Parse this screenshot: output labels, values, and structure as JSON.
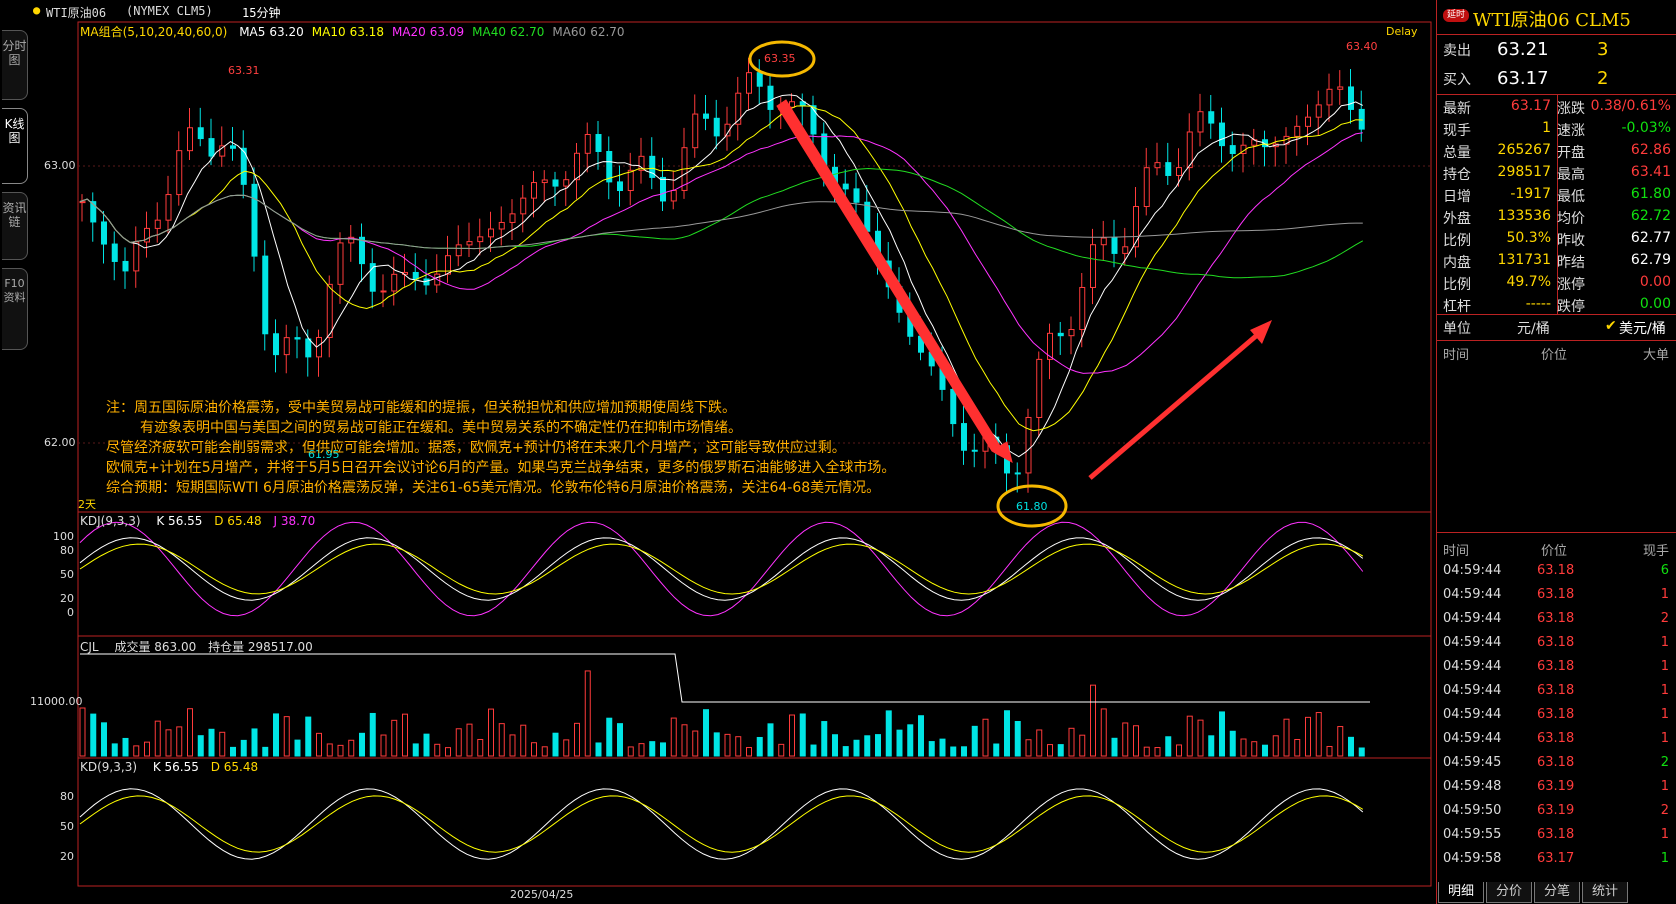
{
  "left_tabs": [
    {
      "label": "分时图"
    },
    {
      "label": "K线图"
    },
    {
      "label": "资讯链"
    },
    {
      "label": "F10资料"
    }
  ],
  "header": {
    "symbol": "WTI原油06",
    "exchange": "(NYMEX CLM5)",
    "period": "15分钟"
  },
  "ma": {
    "label": "MA组合(5,10,20,40,60,0)",
    "items": [
      {
        "name": "MA5",
        "value": "63.20",
        "color": "#ffffff"
      },
      {
        "name": "MA10",
        "value": "63.18",
        "color": "#ffff00"
      },
      {
        "name": "MA20",
        "value": "63.09",
        "color": "#ff33ff"
      },
      {
        "name": "MA40",
        "value": "62.70",
        "color": "#22dd22"
      },
      {
        "name": "MA60",
        "value": "62.70",
        "color": "#999999"
      }
    ]
  },
  "delay": "Delay",
  "price_axis": [
    {
      "label": "63.00",
      "value": 63.0
    },
    {
      "label": "62.00",
      "value": 62.0
    }
  ],
  "annotations": {
    "high_label": "63.35",
    "low_label": "61.80",
    "left_high": "63.31",
    "right_high": "63.40",
    "left_low": "61.95",
    "days": "2天"
  },
  "note_lines": [
    "注：周五国际原油价格震荡，受中美贸易战可能缓和的提振，但关税担忧和供应增加预期使周线下跌。",
    "有迹象表明中国与美国之间的贸易战可能正在缓和。美中贸易关系的不确定性仍在抑制市场情绪。",
    "尽管经济疲软可能会削弱需求，但供应可能会增加。据悉，欧佩克+预计仍将在未来几个月增产，这可能导致供应过剩。",
    "欧佩克+计划在5月增产，并将于5月5日召开会议讨论6月的产量。如果乌克兰战争结束，更多的俄罗斯石油能够进入全球市场。",
    "综合预期：短期国际WTI 6月原油价格震荡反弹，关注61-65美元情况。伦敦布伦特6月原油价格震荡，关注64-68美元情况。"
  ],
  "kdj": {
    "label": "KDJ(9,3,3)",
    "k": "K 56.55",
    "d": "D 65.48",
    "j": "J 38.70",
    "axis": [
      "100",
      "80",
      "50",
      "20",
      "0"
    ]
  },
  "cjl": {
    "label": "CJL",
    "vol": "成交量 863.00",
    "oi": "持仓量 298517.00",
    "axis": "11000.00"
  },
  "kd": {
    "label": "KD(9,3,3)",
    "k": "K 56.55",
    "d": "D 65.48",
    "axis": [
      "80",
      "50",
      "20"
    ]
  },
  "date": "2025/04/25",
  "chart_data": {
    "type": "candlestick",
    "price_ylim": [
      61.7,
      63.55
    ],
    "ticks": [
      {
        "label": "63.00",
        "value": 63.0
      },
      {
        "label": "62.00",
        "value": 62.0
      }
    ],
    "marked": {
      "high": 63.35,
      "low": 61.8
    },
    "date": "2025/04/25"
  },
  "right": {
    "title": "WTI原油06 CLM5",
    "badge": "延时",
    "sell": {
      "label": "卖出",
      "price": "63.21",
      "qty": "3"
    },
    "buy": {
      "label": "买入",
      "price": "63.17",
      "qty": "2"
    },
    "rows": [
      {
        "l1": "最新",
        "v1": "63.17",
        "c1": "red",
        "l2": "涨跌",
        "v2": "0.38/0.61%",
        "c2": "red"
      },
      {
        "l1": "现手",
        "v1": "1",
        "c1": "yel",
        "l2": "速涨",
        "v2": "-0.03%",
        "c2": "green"
      },
      {
        "l1": "总量",
        "v1": "265267",
        "c1": "yel",
        "l2": "开盘",
        "v2": "62.86",
        "c2": "red"
      },
      {
        "l1": "持仓",
        "v1": "298517",
        "c1": "yel",
        "l2": "最高",
        "v2": "63.41",
        "c2": "red"
      },
      {
        "l1": "日增",
        "v1": "-1917",
        "c1": "yel",
        "l2": "最低",
        "v2": "61.80",
        "c2": "green"
      },
      {
        "l1": "外盘",
        "v1": "133536",
        "c1": "yel",
        "l2": "均价",
        "v2": "62.72",
        "c2": "green"
      },
      {
        "l1": "比例",
        "v1": "50.3%",
        "c1": "yel",
        "l2": "昨收",
        "v2": "62.77",
        "c2": "white"
      },
      {
        "l1": "内盘",
        "v1": "131731",
        "c1": "yel",
        "l2": "昨结",
        "v2": "62.79",
        "c2": "white"
      },
      {
        "l1": "比例",
        "v1": "49.7%",
        "c1": "yel",
        "l2": "涨停",
        "v2": "0.00",
        "c2": "red"
      },
      {
        "l1": "杠杆",
        "v1": "-----",
        "c1": "yel",
        "l2": "跌停",
        "v2": "0.00",
        "c2": "green"
      }
    ],
    "unit": {
      "label": "单位",
      "cny": "元/桶",
      "usd": "美元/桶"
    },
    "big_header": [
      "时间",
      "价位",
      "大单"
    ],
    "tick_header": [
      "时间",
      "价位",
      "现手"
    ],
    "ticks": [
      {
        "t": "04:59:44",
        "p": "63.18",
        "q": "6",
        "qc": "green"
      },
      {
        "t": "04:59:44",
        "p": "63.18",
        "q": "1",
        "qc": "red"
      },
      {
        "t": "04:59:44",
        "p": "63.18",
        "q": "2",
        "qc": "red"
      },
      {
        "t": "04:59:44",
        "p": "63.18",
        "q": "1",
        "qc": "red"
      },
      {
        "t": "04:59:44",
        "p": "63.18",
        "q": "1",
        "qc": "red"
      },
      {
        "t": "04:59:44",
        "p": "63.18",
        "q": "1",
        "qc": "red"
      },
      {
        "t": "04:59:44",
        "p": "63.18",
        "q": "1",
        "qc": "red"
      },
      {
        "t": "04:59:44",
        "p": "63.18",
        "q": "1",
        "qc": "red"
      },
      {
        "t": "04:59:45",
        "p": "63.18",
        "q": "2",
        "qc": "green"
      },
      {
        "t": "04:59:48",
        "p": "63.19",
        "q": "1",
        "qc": "red"
      },
      {
        "t": "04:59:50",
        "p": "63.19",
        "q": "2",
        "qc": "red"
      },
      {
        "t": "04:59:55",
        "p": "63.18",
        "q": "1",
        "qc": "red"
      },
      {
        "t": "04:59:58",
        "p": "63.17",
        "q": "1",
        "qc": "green"
      }
    ],
    "bottom_tabs": [
      "明细",
      "分价",
      "分笔",
      "统计"
    ]
  }
}
